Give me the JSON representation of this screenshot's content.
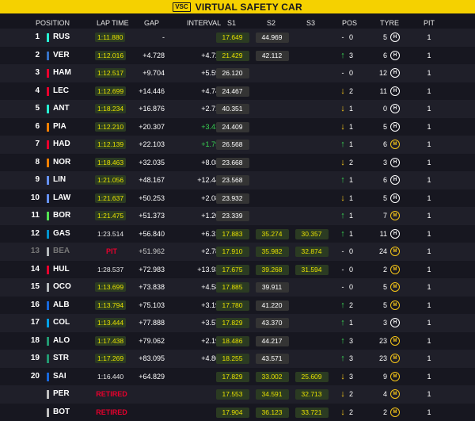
{
  "banner": {
    "badge": "VSC",
    "text": "VIRTUAL SAFETY CAR",
    "color": "#f5d100"
  },
  "columns": [
    "POSITION",
    "LAP TIME",
    "GAP",
    "INTERVAL",
    "S1",
    "S2",
    "S3",
    "POS",
    "TYRE",
    "PIT"
  ],
  "colors": {
    "personal_best_bg": "#2b3b22",
    "personal_best_text": "#e6e000",
    "overall_best_text": "#39d353",
    "pos_up": "#39d353",
    "pos_down": "#f5c518",
    "retired": "#e8002d"
  },
  "tyres": {
    "H": {
      "letter": "H",
      "color": "#ffffff"
    },
    "M": {
      "letter": "M",
      "color": "#f5c518"
    }
  },
  "rows": [
    {
      "pos": "1",
      "code": "RUS",
      "team": "#27f4d2",
      "lap": "1:11.880",
      "lapStyle": "pb",
      "gap": "-",
      "int": "-",
      "intColor": "",
      "s1": "17.649",
      "s1s": "pb",
      "s2": "44.969",
      "s2s": "grey",
      "s3": "",
      "s3s": "",
      "arrow": "",
      "chg": "0",
      "laps": "5",
      "tyre": "H",
      "pit": "1",
      "dim": false
    },
    {
      "pos": "2",
      "code": "VER",
      "team": "#3671c6",
      "lap": "1:12.016",
      "lapStyle": "pb",
      "gap": "+4.728",
      "int": "+4.728",
      "intColor": "",
      "s1": "21.429",
      "s1s": "pb",
      "s2": "42.112",
      "s2s": "grey",
      "s3": "",
      "s3s": "",
      "arrow": "up",
      "chg": "3",
      "laps": "6",
      "tyre": "H",
      "pit": "1",
      "dim": false
    },
    {
      "pos": "3",
      "code": "HAM",
      "team": "#e8002d",
      "lap": "1:12.517",
      "lapStyle": "pb",
      "gap": "+9.704",
      "int": "+5.596",
      "intColor": "",
      "s1": "26.120",
      "s1s": "grey",
      "s2": "",
      "s2s": "",
      "s3": "",
      "s3s": "",
      "arrow": "",
      "chg": "0",
      "laps": "12",
      "tyre": "H",
      "pit": "1",
      "dim": false
    },
    {
      "pos": "4",
      "code": "LEC",
      "team": "#e8002d",
      "lap": "1:12.699",
      "lapStyle": "pb",
      "gap": "+14.446",
      "int": "+4.742",
      "intColor": "",
      "s1": "24.467",
      "s1s": "grey",
      "s2": "",
      "s2s": "",
      "s3": "",
      "s3s": "",
      "arrow": "down",
      "chg": "2",
      "laps": "11",
      "tyre": "H",
      "pit": "1",
      "dim": false
    },
    {
      "pos": "5",
      "code": "ANT",
      "team": "#27f4d2",
      "lap": "1:18.234",
      "lapStyle": "pb",
      "gap": "+16.876",
      "int": "+2.715",
      "intColor": "",
      "s1": "40.351",
      "s1s": "grey",
      "s2": "",
      "s2s": "",
      "s3": "",
      "s3s": "",
      "arrow": "down",
      "chg": "1",
      "laps": "0",
      "tyre": "H",
      "pit": "1",
      "dim": false
    },
    {
      "pos": "6",
      "code": "PIA",
      "team": "#ff8000",
      "lap": "1:12.210",
      "lapStyle": "pb",
      "gap": "+20.307",
      "int": "+3.431",
      "intColor": "green",
      "s1": "24.409",
      "s1s": "grey",
      "s2": "",
      "s2s": "",
      "s3": "",
      "s3s": "",
      "arrow": "down",
      "chg": "1",
      "laps": "5",
      "tyre": "H",
      "pit": "1",
      "dim": false
    },
    {
      "pos": "7",
      "code": "HAD",
      "team": "#e8002d",
      "lap": "1:12.139",
      "lapStyle": "pb",
      "gap": "+22.103",
      "int": "+1.796",
      "intColor": "green",
      "s1": "26.568",
      "s1s": "grey",
      "s2": "",
      "s2s": "",
      "s3": "",
      "s3s": "",
      "arrow": "up",
      "chg": "1",
      "laps": "6",
      "tyre": "M",
      "pit": "1",
      "dim": false
    },
    {
      "pos": "8",
      "code": "NOR",
      "team": "#ff8000",
      "lap": "1:18.463",
      "lapStyle": "pb",
      "gap": "+32.035",
      "int": "+8.085",
      "intColor": "",
      "s1": "23.668",
      "s1s": "grey",
      "s2": "",
      "s2s": "",
      "s3": "",
      "s3s": "",
      "arrow": "down",
      "chg": "2",
      "laps": "3",
      "tyre": "H",
      "pit": "1",
      "dim": false
    },
    {
      "pos": "9",
      "code": "LIN",
      "team": "#6692ff",
      "lap": "1:21.056",
      "lapStyle": "pb",
      "gap": "+48.167",
      "int": "+12.443",
      "intColor": "",
      "s1": "23.568",
      "s1s": "grey",
      "s2": "",
      "s2s": "",
      "s3": "",
      "s3s": "",
      "arrow": "up",
      "chg": "1",
      "laps": "6",
      "tyre": "H",
      "pit": "1",
      "dim": false
    },
    {
      "pos": "10",
      "code": "LAW",
      "team": "#6692ff",
      "lap": "1:21.637",
      "lapStyle": "pb",
      "gap": "+50.253",
      "int": "+2.086",
      "intColor": "",
      "s1": "23.932",
      "s1s": "grey",
      "s2": "",
      "s2s": "",
      "s3": "",
      "s3s": "",
      "arrow": "down",
      "chg": "1",
      "laps": "5",
      "tyre": "H",
      "pit": "1",
      "dim": false
    },
    {
      "pos": "11",
      "code": "BOR",
      "team": "#52e252",
      "lap": "1:21.475",
      "lapStyle": "pb",
      "gap": "+51.373",
      "int": "+1.203",
      "intColor": "",
      "s1": "23.339",
      "s1s": "grey",
      "s2": "",
      "s2s": "",
      "s3": "",
      "s3s": "",
      "arrow": "up",
      "chg": "1",
      "laps": "7",
      "tyre": "M",
      "pit": "1",
      "dim": false
    },
    {
      "pos": "12",
      "code": "GAS",
      "team": "#0093cc",
      "lap": "1:23.514",
      "lapStyle": "white",
      "gap": "+56.840",
      "int": "+6.316",
      "intColor": "",
      "s1": "17.883",
      "s1s": "pb",
      "s2": "35.274",
      "s2s": "pb",
      "s3": "30.357",
      "s3s": "pb",
      "arrow": "up",
      "chg": "1",
      "laps": "11",
      "tyre": "H",
      "pit": "1",
      "dim": false
    },
    {
      "pos": "13",
      "code": "BEA",
      "team": "#b6babd",
      "lap": "PIT",
      "lapStyle": "pit",
      "gap": "+51.962",
      "int": "+2.784",
      "intColor": "",
      "s1": "17.910",
      "s1s": "pb",
      "s2": "35.982",
      "s2s": "pb",
      "s3": "32.874",
      "s3s": "pb",
      "arrow": "",
      "chg": "0",
      "laps": "24",
      "tyre": "M",
      "pit": "1",
      "dim": true
    },
    {
      "pos": "14",
      "code": "HUL",
      "team": "#e8002d",
      "lap": "1:28.537",
      "lapStyle": "white",
      "gap": "+72.983",
      "int": "+13.933",
      "intColor": "",
      "s1": "17.675",
      "s1s": "pb",
      "s2": "39.268",
      "s2s": "pb",
      "s3": "31.594",
      "s3s": "pb",
      "arrow": "",
      "chg": "0",
      "laps": "2",
      "tyre": "M",
      "pit": "1",
      "dim": false
    },
    {
      "pos": "15",
      "code": "OCO",
      "team": "#b6babd",
      "lap": "1:13.699",
      "lapStyle": "pb",
      "gap": "+73.838",
      "int": "+4.585",
      "intColor": "",
      "s1": "17.885",
      "s1s": "pb",
      "s2": "39.911",
      "s2s": "grey",
      "s3": "",
      "s3s": "",
      "arrow": "",
      "chg": "0",
      "laps": "5",
      "tyre": "M",
      "pit": "1",
      "dim": false
    },
    {
      "pos": "16",
      "code": "ALB",
      "team": "#1868db",
      "lap": "1:13.794",
      "lapStyle": "pb",
      "gap": "+75.103",
      "int": "+3.191",
      "intColor": "",
      "s1": "17.780",
      "s1s": "pb",
      "s2": "41.220",
      "s2s": "grey",
      "s3": "",
      "s3s": "",
      "arrow": "up",
      "chg": "2",
      "laps": "5",
      "tyre": "M",
      "pit": "1",
      "dim": false
    },
    {
      "pos": "17",
      "code": "COL",
      "team": "#00a1e8",
      "lap": "1:13.444",
      "lapStyle": "pb",
      "gap": "+77.888",
      "int": "+3.577",
      "intColor": "",
      "s1": "17.829",
      "s1s": "pb",
      "s2": "43.370",
      "s2s": "grey",
      "s3": "",
      "s3s": "",
      "arrow": "up",
      "chg": "1",
      "laps": "3",
      "tyre": "H",
      "pit": "1",
      "dim": false
    },
    {
      "pos": "18",
      "code": "ALO",
      "team": "#229971",
      "lap": "1:17.438",
      "lapStyle": "pb",
      "gap": "+79.062",
      "int": "+2.192",
      "intColor": "",
      "s1": "18.486",
      "s1s": "pb",
      "s2": "44.217",
      "s2s": "grey",
      "s3": "",
      "s3s": "",
      "arrow": "up",
      "chg": "3",
      "laps": "23",
      "tyre": "M",
      "pit": "1",
      "dim": false
    },
    {
      "pos": "19",
      "code": "STR",
      "team": "#229971",
      "lap": "1:17.269",
      "lapStyle": "pb",
      "gap": "+83.095",
      "int": "+4.866",
      "intColor": "",
      "s1": "18.255",
      "s1s": "pb",
      "s2": "43.571",
      "s2s": "grey",
      "s3": "",
      "s3s": "",
      "arrow": "up",
      "chg": "3",
      "laps": "23",
      "tyre": "M",
      "pit": "1",
      "dim": false
    },
    {
      "pos": "20",
      "code": "SAI",
      "team": "#1868db",
      "lap": "1:16.440",
      "lapStyle": "white",
      "gap": "+64.829",
      "int": "",
      "intColor": "",
      "s1": "17.829",
      "s1s": "pb",
      "s2": "33.002",
      "s2s": "pb",
      "s3": "25.609",
      "s3s": "pb",
      "arrow": "down",
      "chg": "3",
      "laps": "9",
      "tyre": "M",
      "pit": "1",
      "dim": false
    },
    {
      "pos": "",
      "code": "PER",
      "team": "#c0c0c0",
      "lap": "RETIRED",
      "lapStyle": "pit",
      "gap": "",
      "int": "",
      "intColor": "",
      "s1": "17.553",
      "s1s": "pb",
      "s2": "34.591",
      "s2s": "pb",
      "s3": "32.713",
      "s3s": "pb",
      "arrow": "down",
      "chg": "2",
      "laps": "4",
      "tyre": "M",
      "pit": "1",
      "dim": false
    },
    {
      "pos": "",
      "code": "BOT",
      "team": "#c0c0c0",
      "lap": "RETIRED",
      "lapStyle": "pit",
      "gap": "",
      "int": "",
      "intColor": "",
      "s1": "17.904",
      "s1s": "pb",
      "s2": "36.123",
      "s2s": "pb",
      "s3": "33.721",
      "s3s": "pb",
      "arrow": "down",
      "chg": "2",
      "laps": "2",
      "tyre": "M",
      "pit": "1",
      "dim": false
    }
  ]
}
